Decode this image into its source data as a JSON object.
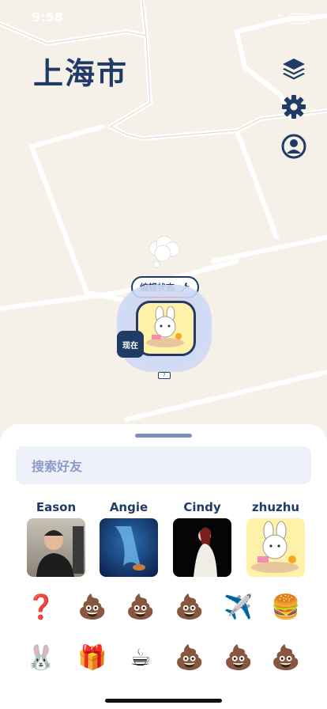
{
  "status_bar": {
    "time": "9:58"
  },
  "map": {
    "city": "上海市"
  },
  "side_buttons": [
    "layers-icon",
    "gear-icon",
    "user-profile-icon"
  ],
  "marker": {
    "edit_label": "编辑状态",
    "now_label": "现在",
    "battery_hint": "?"
  },
  "sheet": {
    "search_placeholder": "搜索好友",
    "friends": [
      {
        "name": "Eason"
      },
      {
        "name": "Angie"
      },
      {
        "name": "Cindy"
      },
      {
        "name": "zhuzhu"
      }
    ],
    "emoji_rows": [
      [
        "❓",
        "💩",
        "💩",
        "💩",
        "✈️",
        "🍔"
      ],
      [
        "🐰",
        "🎁",
        "☕",
        "💩",
        "💩",
        "💩"
      ]
    ]
  },
  "colors": {
    "accent": "#1f3b66",
    "search_bg": "#eef1f9",
    "map_bg": "#f6f1e8"
  }
}
